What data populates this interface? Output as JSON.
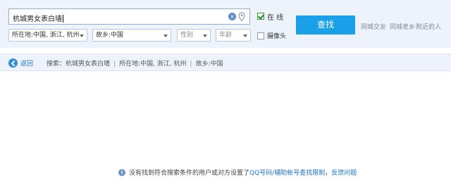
{
  "search": {
    "query": "杭城男女表白墙",
    "online_label": "在  线",
    "online_checked": true,
    "button_label": "查找"
  },
  "filters": {
    "location": "所在地:中国, 浙江, 杭州",
    "hometown": "故乡:中国",
    "gender": "性别",
    "age": "年龄",
    "camera_label": "摄像头",
    "camera_checked": false
  },
  "quick_links": [
    "同城交友",
    "同城老乡",
    "附近的人"
  ],
  "nav": {
    "back_label": "返回",
    "crumbs": [
      "搜索：杭城男女表白墙",
      "所在地:中国, 浙江, 杭州",
      "故乡:中国"
    ]
  },
  "footer": {
    "message": "没有找到符合搜索条件的用户或对方设置了",
    "link1": "QQ号码/辅助帐号查找限制",
    "separator": "，",
    "link2": "反馈问题"
  },
  "colors": {
    "accent": "#1aa0e8",
    "header_bg": "#eef3fb",
    "link": "#1d74c5"
  },
  "icons": [
    "clear-icon",
    "location-pin-icon",
    "back-arrow-icon",
    "info-icon",
    "dropdown-arrow-icon"
  ]
}
